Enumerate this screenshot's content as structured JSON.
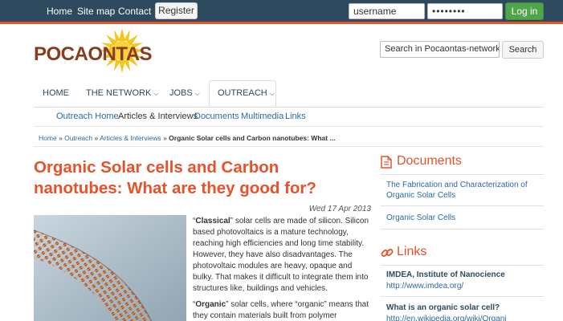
{
  "topnav": {
    "home": "Home",
    "sitemap": "Site map",
    "contact": "Contact",
    "register": "Register",
    "username_value": "username",
    "password_value": "••••••••",
    "login": "Log in"
  },
  "header": {
    "logo_text": "POCAONTAS",
    "search_placeholder": "Search in Pocaontas-network.eu",
    "search_button": "Search"
  },
  "mainnav": {
    "items": [
      {
        "label": "HOME"
      },
      {
        "label": "THE NETWORK"
      },
      {
        "label": "JOBS"
      },
      {
        "label": "OUTREACH"
      }
    ]
  },
  "subnav": {
    "items": [
      {
        "label": "Outreach Home"
      },
      {
        "label": "Articles & Interviews"
      },
      {
        "label": "Documents"
      },
      {
        "label": "Multimedia"
      },
      {
        "label": "Links"
      }
    ]
  },
  "breadcrumb": {
    "home": "Home",
    "outreach": "Outreach",
    "articles": "Articles & Interviews",
    "current": "Organic Solar cells and Carbon nanotubes: What ...",
    "sep": "»"
  },
  "article": {
    "title": "Organic Solar cells and Carbon nanotubes: What are they good for?",
    "date": "Wed 17 Apr 2013",
    "p1_lead": "Classical",
    "p1_rest": " solar cells are made of silicon. Silicon based photovoltaics is a mature technology, reaching high efficiencies and long time stability. However, they have also disadvantages. The photovoltaic modules are heavy, opaque and bulky. That makes it difficult to integrate them into structures like, buildings and vehicles.",
    "p2_lead": "Organic",
    "p2_rest": " solar cells, where “organic” means that they contain materials built from polymer chemistry,",
    "quote_open": "“",
    "quote_close": "”"
  },
  "sidebar": {
    "documents_title": "Documents",
    "documents": [
      {
        "label": "The Fabrication and Characterization of Organic Solar Cells"
      },
      {
        "label": "Organic Solar Cells"
      }
    ],
    "links_title": "Links",
    "links": [
      {
        "title": "IMDEA, Institute of Nanocience",
        "url": "http://www.imdea.org/"
      },
      {
        "title": "What is an organic solar cell?",
        "url": "http://en.wikipedia.org/wiki/Organi"
      }
    ]
  },
  "colors": {
    "topbar": "#2d4a5e",
    "accent": "#e8512a",
    "link": "#2b6aa5",
    "login_green": "#4fa64a"
  }
}
